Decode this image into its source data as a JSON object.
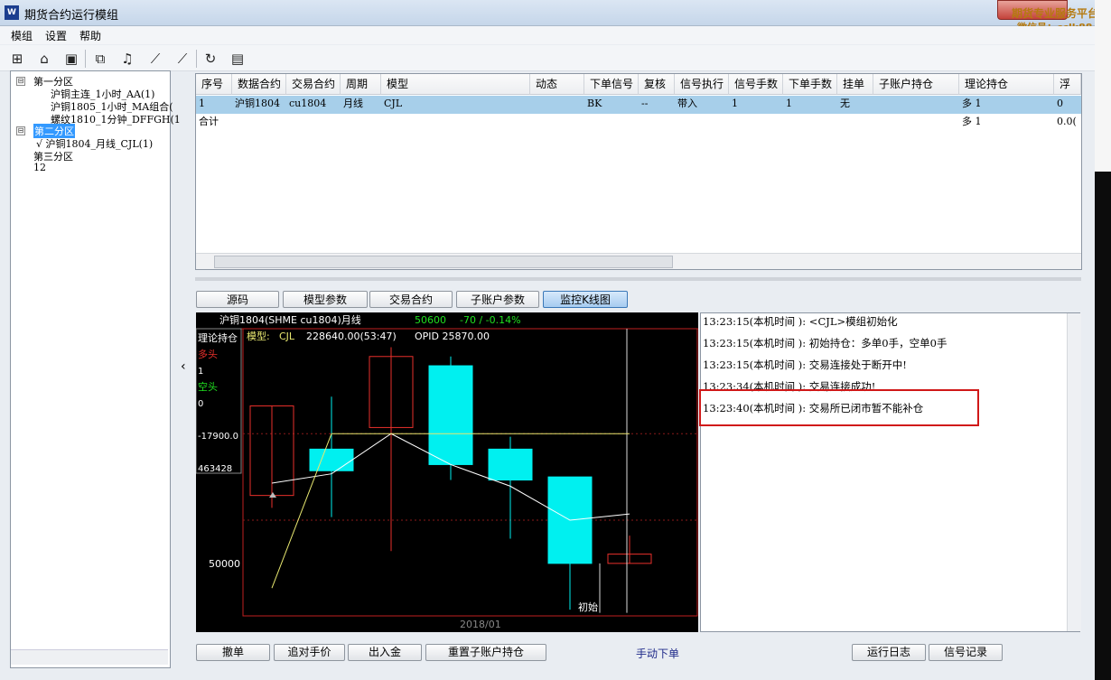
{
  "window": {
    "title": "期货合约运行模组",
    "watermark_line1": "期货专业服务平台",
    "watermark_line2": "微信号：cclk88"
  },
  "menu": [
    "模组",
    "设置",
    "帮助"
  ],
  "toolbar_icons": [
    "new-icon",
    "open-folder-icon",
    "save-icon",
    "chart-icon",
    "bell-icon",
    "signal-line-icon",
    "signal-line2-icon",
    "refresh-icon",
    "report-icon"
  ],
  "tree": [
    {
      "label": "第一分区",
      "toggle": "⊟",
      "level": 0
    },
    {
      "label": "沪铜主连_1小时_AA(1)",
      "level": 1
    },
    {
      "label": "沪铜1805_1小时_MA组合(",
      "level": 1
    },
    {
      "label": "螺纹1810_1分钟_DFFGH(1",
      "level": 1
    },
    {
      "label": "第二分区",
      "toggle": "⊟",
      "level": 0,
      "selected": true
    },
    {
      "label": "√ 沪铜1804_月线_CJL(1)",
      "level": 1
    },
    {
      "label": "第三分区",
      "level": 0
    },
    {
      "label": "12",
      "level": 0
    }
  ],
  "grid": {
    "columns": [
      "序号",
      "数据合约",
      "交易合约",
      "周期",
      "模型",
      "动态",
      "下单信号",
      "复核",
      "信号执行",
      "信号手数",
      "下单手数",
      "挂单",
      "子账户持仓",
      "理论持仓",
      "浮"
    ],
    "rows": [
      [
        "1",
        "沪铜1804",
        "cu1804",
        "月线",
        "CJL",
        "",
        "BK",
        "--",
        "带入",
        "1",
        "1",
        "无",
        "",
        "多 1",
        "0"
      ],
      [
        "合计",
        "",
        "",
        "",
        "",
        "",
        "",
        "",
        "",
        "",
        "",
        "",
        "",
        "多 1",
        "0.0("
      ]
    ]
  },
  "tabs": [
    "源码",
    "模型参数",
    "交易合约",
    "子账户参数",
    "监控K线图"
  ],
  "chart": {
    "header": "沪铜1804(SHME cu1804)月线",
    "last_price": "50600",
    "change": "-70 / -0.14%",
    "model_label": "模型:",
    "model_name": "CJL",
    "model_value": "228640.00(53:47)",
    "opid": "OPID 25870.00",
    "side_title": "理论持仓",
    "long_label": "多头",
    "long_value": "1",
    "short_label": "空头",
    "short_value": "0",
    "pnl_value": "-17900.0",
    "equity_value": "463428",
    "price_label": "50000",
    "init_label": "初始",
    "date_label": "2018/01"
  },
  "chart_data": {
    "type": "candlestick",
    "candles": [
      {
        "open": 53700,
        "close": 50800,
        "high": 53700,
        "low": 50400,
        "bull": true
      },
      {
        "open": 51600,
        "close": 52300,
        "high": 54000,
        "low": 50100,
        "bull": false
      },
      {
        "open": 53000,
        "close": 55300,
        "high": 55600,
        "low": 49000,
        "bull": true
      },
      {
        "open": 55000,
        "close": 51800,
        "high": 55300,
        "low": 51300,
        "bull": false
      },
      {
        "open": 52300,
        "close": 51300,
        "high": 52700,
        "low": 49400,
        "bull": false
      },
      {
        "open": 51400,
        "close": 48600,
        "high": 51400,
        "low": 47100,
        "bull": false
      },
      {
        "open": 48600,
        "close": 48900,
        "high": 49500,
        "low": 48600,
        "bull": true
      }
    ],
    "ma": [
      51200,
      51500,
      52800,
      51800,
      51100,
      50000,
      50200
    ],
    "ref_line": 52800,
    "ylim": [
      46900,
      56200
    ]
  },
  "log": [
    "13:23:15(本机时间    ): <CJL>模组初始化",
    "13:23:15(本机时间    ): 初始持仓：多单0手，空单0手",
    "13:23:15(本机时间    ): 交易连接处于断开中!",
    "13:23:34(本机时间    ): 交易连接成功!",
    "13:23:40(本机时间    ): 交易所已闭市暂不能补仓"
  ],
  "buttons": [
    "撤单",
    "追对手价",
    "出入金",
    "重置子账户持仓",
    "手动下单",
    "运行日志",
    "信号记录"
  ],
  "colors": {
    "bull": "#e8302b",
    "bear": "#00f0f0",
    "selection": "#a7cfea",
    "highlight": "#d01818"
  }
}
